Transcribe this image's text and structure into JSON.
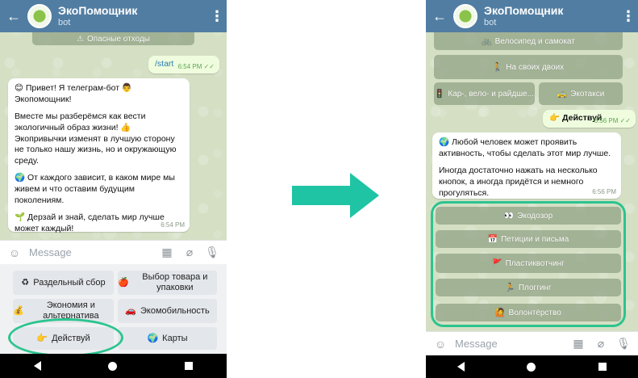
{
  "left": {
    "header": {
      "title": "ЭкоПомощник",
      "subtitle": "bot"
    },
    "inline_top": {
      "icon": "⚠",
      "label": "Опасные отходы"
    },
    "start_msg": {
      "text": "/start",
      "time": "6:54 PM ✓✓"
    },
    "welcome": {
      "p1": "😊 Привет! Я телеграм-бот 👨 Экопомощник!",
      "p2": "Вместе мы разберёмся как вести экологичный образ жизни! 👍 Экопривычки изменят в лучшую сторону не только нашу жизнь, но и окружающую среду.",
      "p3": "🌍 От каждого зависит, в каком мире мы живем и что оставим будущим поколениям.",
      "p4": "🌱 Дерзай и знай, сделать мир лучше может каждый!",
      "time": "6:54 PM"
    },
    "input": {
      "placeholder": "Message"
    },
    "keyboard": [
      {
        "icon": "♻",
        "label": "Раздельный сбор"
      },
      {
        "icon": "🍎",
        "label": "Выбор товара и упаковки"
      },
      {
        "icon": "💰",
        "label": "Экономия и альтернатива"
      },
      {
        "icon": "🚗",
        "label": "Экомобильность"
      },
      {
        "icon": "👉",
        "label": "Действуй"
      },
      {
        "icon": "🌍",
        "label": "Карты"
      }
    ]
  },
  "right": {
    "header": {
      "title": "ЭкоПомощник",
      "subtitle": "bot"
    },
    "inline_top": [
      {
        "icon": "🚲",
        "label": "Велосипед и самокат"
      },
      {
        "icon": "🚶",
        "label": "На своих двоих"
      },
      {
        "icon": "🚦",
        "label": "Кар-, вело- и райдше..."
      },
      {
        "icon": "🚕",
        "label": "Экотакси"
      }
    ],
    "action_msg": {
      "text": "👉 Действуй",
      "time": "6:56 PM ✓✓"
    },
    "reply": {
      "p1": "🌍 Любой человек может проявить активность, чтобы сделать этот мир лучше.",
      "p2": "Иногда достаточно нажать на несколько кнопок, а иногда придётся и немного прогуляться.",
      "time": "6:56 PM"
    },
    "inline_actions": [
      {
        "icon": "👀",
        "label": "Экодозор"
      },
      {
        "icon": "📅",
        "label": "Петиции и письма"
      },
      {
        "icon": "🚩",
        "label": "Пластиквотчинг"
      },
      {
        "icon": "🏃",
        "label": "Плоггинг"
      },
      {
        "icon": "🙋",
        "label": "Волонтёрство"
      }
    ],
    "input": {
      "placeholder": "Message"
    }
  },
  "colors": {
    "header": "#517da2",
    "highlight": "#2bc48e",
    "arrow": "#1fc4a4",
    "out_bubble": "#effdde"
  }
}
